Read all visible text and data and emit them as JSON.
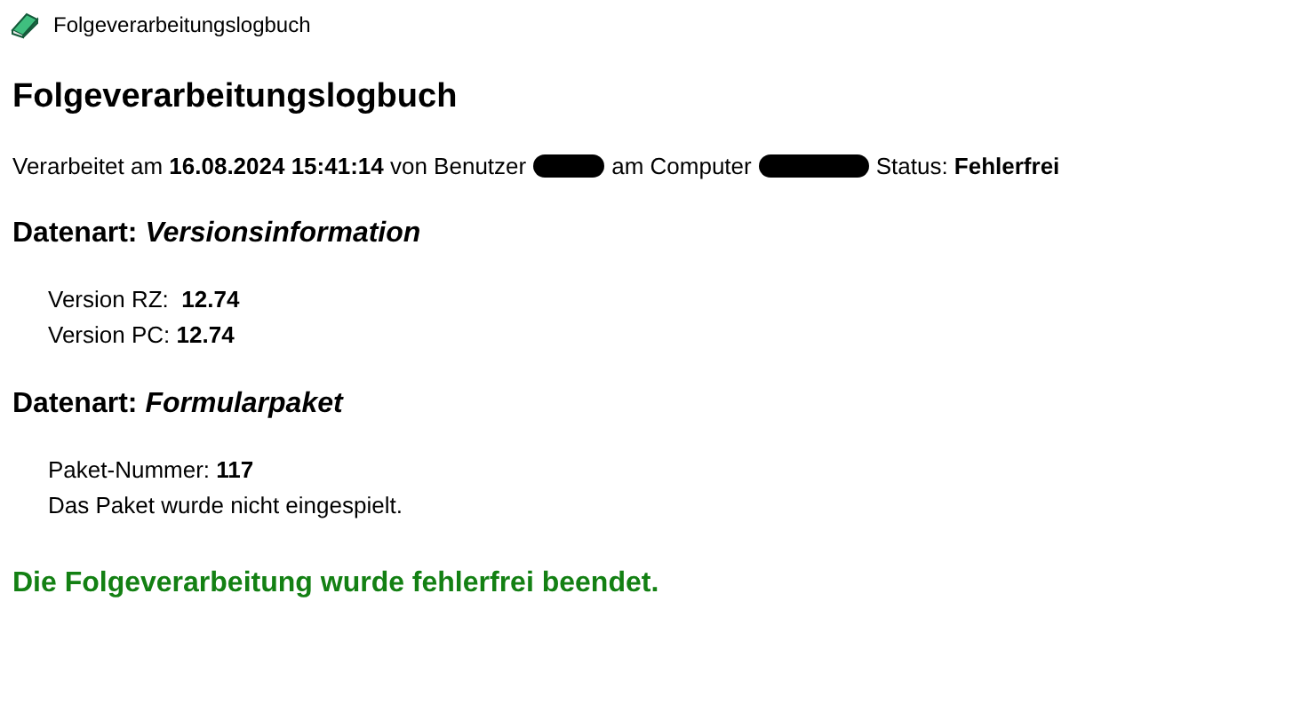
{
  "window": {
    "title": "Folgeverarbeitungslogbuch"
  },
  "heading": "Folgeverarbeitungslogbuch",
  "info_line": [
    {
      "kind": "text",
      "text": "Verarbeitet am **16.08.2024 15:41:14** von Benutzer"
    },
    {
      "kind": "redacted"
    },
    {
      "kind": "text",
      "text": "am Computer"
    },
    {
      "kind": "redacted"
    },
    {
      "kind": "text",
      "text": "Status: **Fehlerfrei**"
    }
  ],
  "sections": [
    {
      "title": "Datenart: *Versionsinformation*",
      "lines": [
        "Version RZ:  **12.74**",
        "Version PC: **12.74**"
      ]
    },
    {
      "title": "Datenart: *Formularpaket*",
      "lines": [
        "Paket-Nummer: **117**",
        "Das Paket wurde nicht eingespielt."
      ]
    }
  ],
  "result": {
    "text": "Die Folgeverarbeitung wurde fehlerfrei beendet.",
    "color": "#138013"
  }
}
